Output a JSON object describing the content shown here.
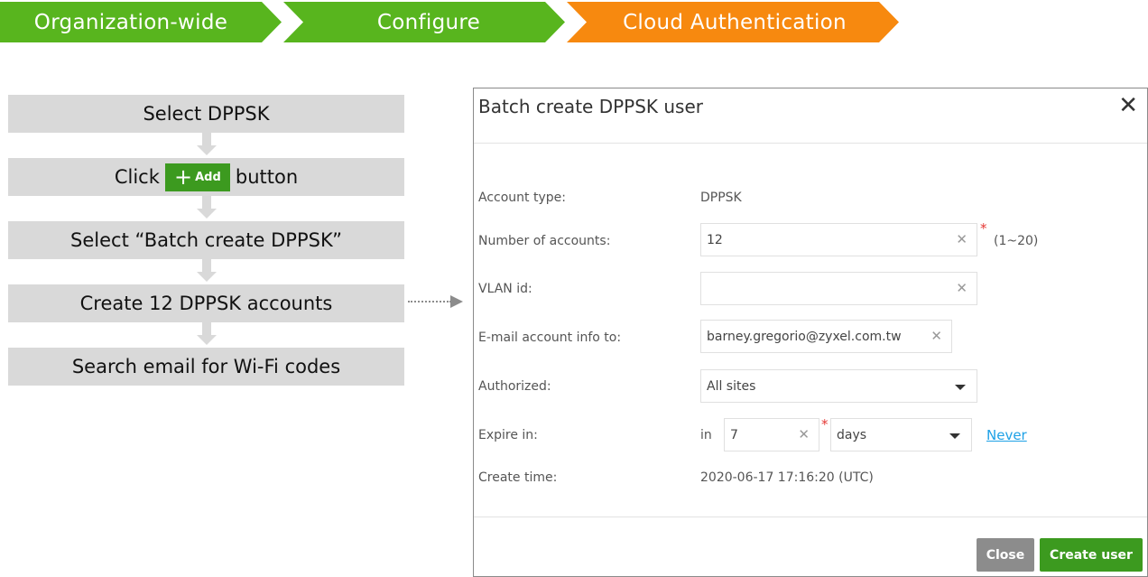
{
  "breadcrumb": {
    "items": [
      {
        "label": "Organization-wide",
        "color": "#58b51e"
      },
      {
        "label": "Configure",
        "color": "#58b51e"
      },
      {
        "label": "Cloud Authentication",
        "color": "#f7890f"
      }
    ]
  },
  "flow": {
    "step1": "Select DPPSK",
    "step2_prefix": "Click",
    "step2_button": "Add",
    "step2_button_icon": "plus-icon",
    "step2_suffix": "button",
    "step3": "Select “Batch create DPPSK”",
    "step4": "Create 12 DPPSK accounts",
    "step5": "Search email for Wi-Fi codes"
  },
  "modal": {
    "title": "Batch create DPPSK user",
    "close_icon": "close-icon",
    "account_type": {
      "label": "Account type:",
      "value": "DPPSK"
    },
    "number_of_accounts": {
      "label": "Number of accounts:",
      "value": "12",
      "required": "*",
      "hint": "(1~20)"
    },
    "vlan_id": {
      "label": "VLAN id:",
      "value": ""
    },
    "email": {
      "label": "E-mail account info to:",
      "value": "barney.gregorio@zyxel.com.tw"
    },
    "authorized": {
      "label": "Authorized:",
      "value": "All sites"
    },
    "expire": {
      "label": "Expire in:",
      "prefix": "in",
      "value": "7",
      "required": "*",
      "unit": "days",
      "never_link": "Never"
    },
    "create_time": {
      "label": "Create time:",
      "value": "2020-06-17 17:16:20 (UTC)"
    },
    "buttons": {
      "close": "Close",
      "create": "Create user"
    }
  },
  "colors": {
    "green": "#58b51e",
    "orange": "#f7890f",
    "button_green": "#3c9a1f",
    "button_gray": "#8c8c8c",
    "link_blue": "#1ea1e6",
    "required_red": "#e53935"
  }
}
